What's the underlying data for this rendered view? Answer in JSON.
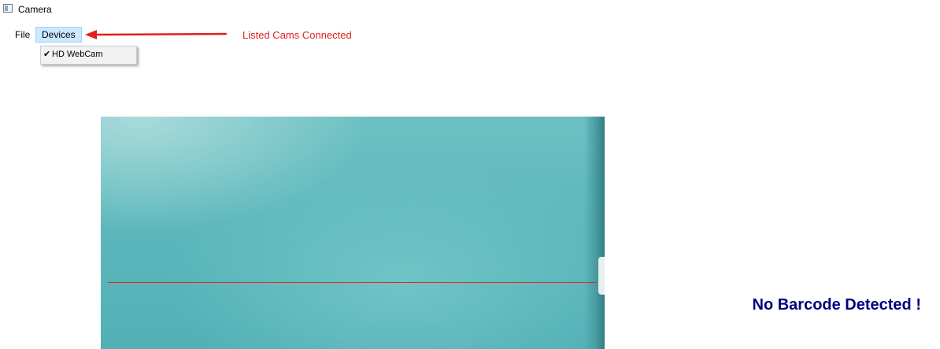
{
  "window": {
    "title": "Camera"
  },
  "menu": {
    "file_label": "File",
    "devices_label": "Devices"
  },
  "devices_menu": {
    "items": [
      {
        "label": "HD WebCam",
        "checked": true,
        "check_glyph": "✔"
      }
    ]
  },
  "annotation": {
    "text": "Listed Cams Connected",
    "color": "#e0201c"
  },
  "camera": {
    "scan_line_color": "#e0291d"
  },
  "status": {
    "text": "No Barcode Detected !",
    "color": "#000080"
  }
}
